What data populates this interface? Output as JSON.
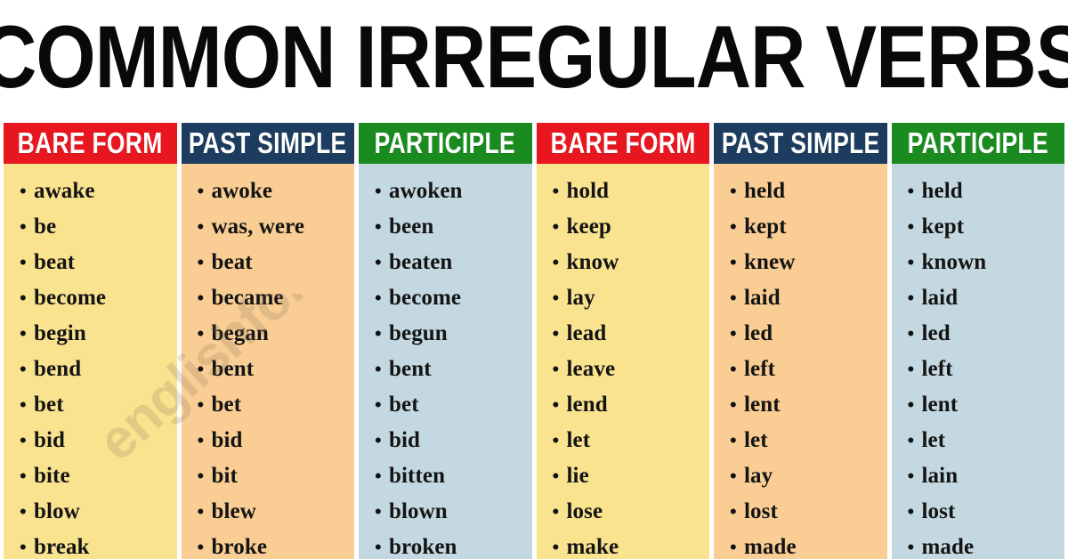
{
  "page": {
    "title": "COMMON IRREGULAR VERBS",
    "watermark": "englishforums.com",
    "background_color": "#FFFFFF"
  },
  "colors": {
    "header_red": "#E8171F",
    "header_navy": "#1C3D5F",
    "header_green": "#1A8C1F",
    "body_yellow": "#FAE38F",
    "body_peach": "#F9CD93",
    "body_blue": "#C3D8E0",
    "text_dark": "#141414",
    "header_text": "#FFFFFF"
  },
  "bullet_glyph": "•",
  "columns": [
    {
      "header": "BARE FORM",
      "header_style": "red",
      "body_style": "yellow",
      "items": [
        "awake",
        "be",
        "beat",
        "become",
        "begin",
        "bend",
        "bet",
        "bid",
        "bite",
        "blow",
        "break"
      ]
    },
    {
      "header": "PAST SIMPLE",
      "header_style": "navy",
      "body_style": "peach",
      "items": [
        "awoke",
        "was, were",
        "beat",
        "became",
        "began",
        "bent",
        "bet",
        "bid",
        "bit",
        "blew",
        "broke"
      ]
    },
    {
      "header": "PARTICIPLE",
      "header_style": "green",
      "body_style": "blue",
      "items": [
        "awoken",
        "been",
        "beaten",
        "become",
        "begun",
        "bent",
        "bet",
        "bid",
        "bitten",
        "blown",
        "broken"
      ]
    },
    {
      "header": "BARE FORM",
      "header_style": "red",
      "body_style": "yellow",
      "items": [
        "hold",
        "keep",
        "know",
        "lay",
        "lead",
        "leave",
        "lend",
        "let",
        "lie",
        "lose",
        "make"
      ]
    },
    {
      "header": "PAST SIMPLE",
      "header_style": "navy",
      "body_style": "peach",
      "items": [
        "held",
        "kept",
        "knew",
        "laid",
        "led",
        "left",
        "lent",
        "let",
        "lay",
        "lost",
        "made"
      ]
    },
    {
      "header": "PARTICIPLE",
      "header_style": "green",
      "body_style": "blue",
      "items": [
        "held",
        "kept",
        "known",
        "laid",
        "led",
        "left",
        "lent",
        "let",
        "lain",
        "lost",
        "made"
      ]
    }
  ]
}
